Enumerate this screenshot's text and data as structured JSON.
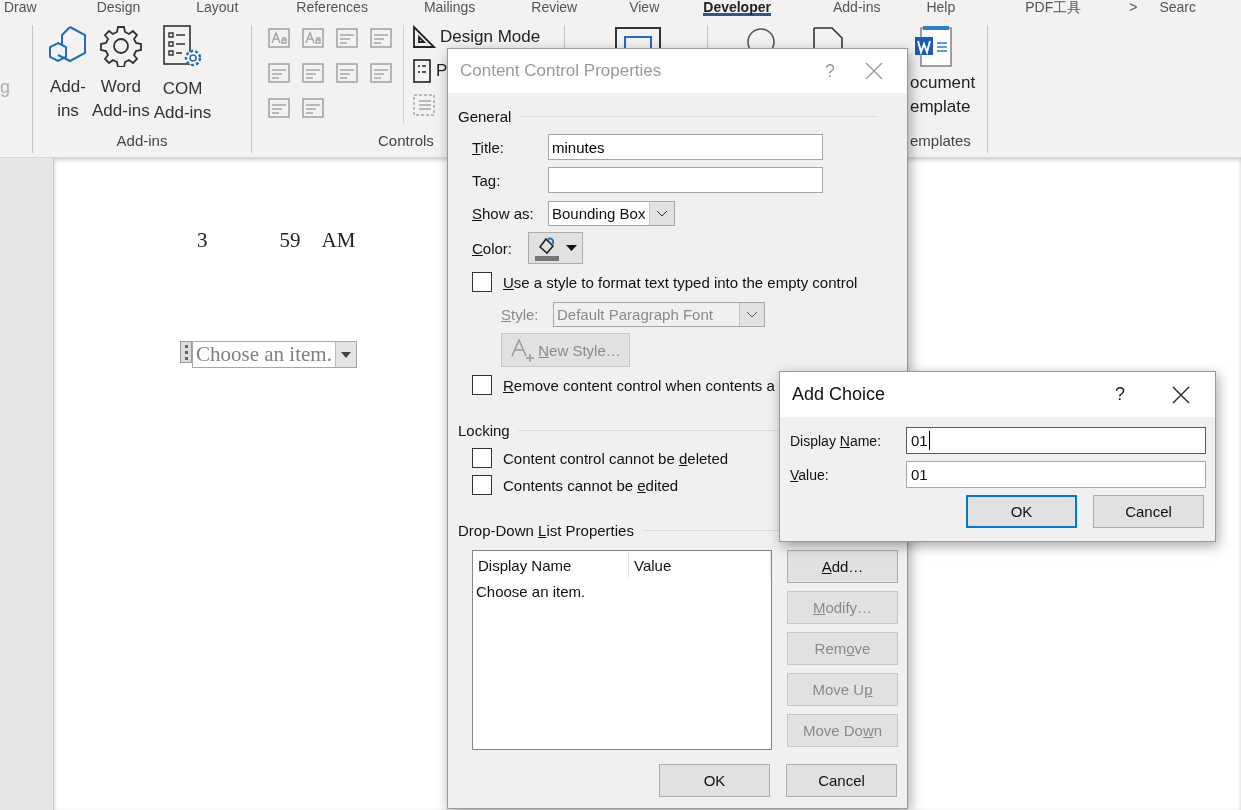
{
  "ribbon_tabs": [
    {
      "label": "Draw",
      "selected": false
    },
    {
      "label": "Design",
      "selected": false
    },
    {
      "label": "Layout",
      "selected": false
    },
    {
      "label": "References",
      "selected": false
    },
    {
      "label": "Mailings",
      "selected": false
    },
    {
      "label": "Review",
      "selected": false
    },
    {
      "label": "View",
      "selected": false
    },
    {
      "label": "Developer",
      "selected": true
    },
    {
      "label": "Add-ins",
      "selected": false
    },
    {
      "label": "Help",
      "selected": false
    },
    {
      "label": "PDF工具",
      "selected": false
    },
    {
      "label": ">",
      "selected": false
    },
    {
      "label": "Searc",
      "selected": false
    }
  ],
  "ribbon": {
    "clipped_label": "g",
    "addins_group": {
      "label": "Add-ins",
      "buttons": [
        {
          "kind": "hexagons",
          "lines": [
            "Add-",
            "ins"
          ]
        },
        {
          "kind": "gear",
          "lines": [
            "Word",
            "Add-ins"
          ]
        },
        {
          "kind": "list-gear",
          "lines": [
            "COM",
            "Add-ins"
          ]
        }
      ]
    },
    "controls_group": {
      "label": "Controls",
      "design_mode": "Design Mode",
      "properties": "P"
    },
    "templates_group": {
      "label": "emplates",
      "button_lines": [
        "ocument",
        "emplate"
      ]
    }
  },
  "document": {
    "time_parts": [
      "3",
      "59",
      "AM"
    ],
    "dropdown": {
      "text": "Choose an item."
    }
  },
  "properties_dialog": {
    "title": "Content Control Properties",
    "help": "?",
    "general": {
      "heading": "General",
      "title_field": {
        "label": {
          "key": "T",
          "post": "itle:"
        },
        "value": "minutes"
      },
      "tag_field": {
        "label": {
          "pre": "Ta",
          "key": "g",
          "post": ":"
        }
      },
      "show_as": {
        "label": {
          "key": "S",
          "post": "how as:"
        },
        "value": "Bounding Box"
      },
      "color": {
        "label": {
          "key": "C",
          "post": "olor:"
        }
      },
      "use_style": {
        "label": {
          "key": "U",
          "post": "se a style to format text typed into the empty control"
        },
        "checked": false
      },
      "style": {
        "label": {
          "key": "S",
          "post": "tyle:"
        },
        "value": "Default Paragraph Font",
        "disabled": true
      },
      "new_style": {
        "label": {
          "key": "N",
          "post": "ew Style…"
        },
        "disabled": true
      },
      "remove_control": {
        "label": {
          "key": "R",
          "post": "emove content control when contents a"
        },
        "checked": false
      }
    },
    "locking": {
      "heading": "Locking",
      "options": [
        {
          "label": {
            "pre": "Content control cannot be ",
            "key": "d",
            "post": "eleted"
          },
          "checked": false
        },
        {
          "label": {
            "pre": "Contents cannot be ",
            "key": "e",
            "post": "dited"
          },
          "checked": false
        }
      ]
    },
    "list_properties": {
      "heading": {
        "pre": "Drop-Down ",
        "key": "L",
        "post": "ist Properties"
      },
      "columns": [
        "Display Name",
        "Value"
      ],
      "rows": [
        {
          "display_name": "Choose an item."
        }
      ],
      "buttons": [
        {
          "label": {
            "key": "A",
            "post": "dd…"
          },
          "disabled": false
        },
        {
          "label": {
            "key": "M",
            "post": "odify…"
          },
          "disabled": true
        },
        {
          "label": {
            "pre": "Rem",
            "key": "o",
            "post": "ve"
          },
          "disabled": true
        },
        {
          "label": {
            "pre": "Move U",
            "key": "p"
          },
          "disabled": true
        },
        {
          "label": {
            "pre": "Move Do",
            "key": "w",
            "post": "n"
          },
          "disabled": true
        }
      ]
    },
    "footer_buttons": [
      {
        "label": "OK"
      },
      {
        "label": "Cancel"
      }
    ]
  },
  "add_choice_dialog": {
    "title": "Add Choice",
    "help": "?",
    "fields": [
      {
        "label": {
          "pre": "Display ",
          "key": "N",
          "post": "ame:"
        },
        "value": "01",
        "focused": true
      },
      {
        "label": {
          "key": "V",
          "post": "alue:"
        },
        "value": "01",
        "focused": false
      }
    ],
    "buttons": [
      {
        "label": "OK",
        "default": true
      },
      {
        "label": "Cancel",
        "default": false
      }
    ]
  }
}
